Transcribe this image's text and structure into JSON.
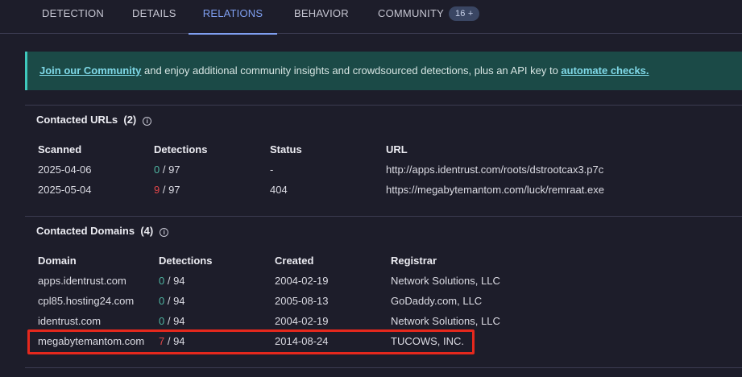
{
  "tabs": [
    {
      "label": "DETECTION"
    },
    {
      "label": "DETAILS"
    },
    {
      "label": "RELATIONS"
    },
    {
      "label": "BEHAVIOR"
    },
    {
      "label": "COMMUNITY",
      "badge": "16 +"
    }
  ],
  "banner": {
    "link1": "Join our Community",
    "text": " and enjoy additional community insights and crowdsourced detections, plus an API key to ",
    "link2": "automate checks."
  },
  "urls": {
    "title": "Contacted URLs",
    "count": "(2)",
    "info_icon": "info-icon",
    "headers": [
      "Scanned",
      "Detections",
      "Status",
      "URL"
    ],
    "rows": [
      {
        "scanned": "2025-04-06",
        "det": "0",
        "total": " / 97",
        "status": "-",
        "url": "http://apps.identrust.com/roots/dstrootcax3.p7c"
      },
      {
        "scanned": "2025-05-04",
        "det": "9",
        "total": " / 97",
        "status": "404",
        "url": "https://megabytemantom.com/luck/remraat.exe"
      }
    ]
  },
  "domains": {
    "title": "Contacted Domains",
    "count": "(4)",
    "info_icon": "info-icon",
    "headers": [
      "Domain",
      "Detections",
      "Created",
      "Registrar"
    ],
    "rows": [
      {
        "domain": "apps.identrust.com",
        "det": "0",
        "total": " / 94",
        "created": "2004-02-19",
        "registrar": "Network Solutions, LLC"
      },
      {
        "domain": "cpl85.hosting24.com",
        "det": "0",
        "total": " / 94",
        "created": "2005-08-13",
        "registrar": "GoDaddy.com, LLC"
      },
      {
        "domain": "identrust.com",
        "det": "0",
        "total": " / 94",
        "created": "2004-02-19",
        "registrar": "Network Solutions, LLC"
      },
      {
        "domain": "megabytemantom.com",
        "det": "7",
        "total": " / 94",
        "created": "2014-08-24",
        "registrar": "TUCOWS, INC."
      }
    ]
  },
  "colors": {
    "accent": "#7f9ff0",
    "clean": "#4fb5a1",
    "malicious": "#e2474a",
    "highlight": "#e5281d"
  }
}
